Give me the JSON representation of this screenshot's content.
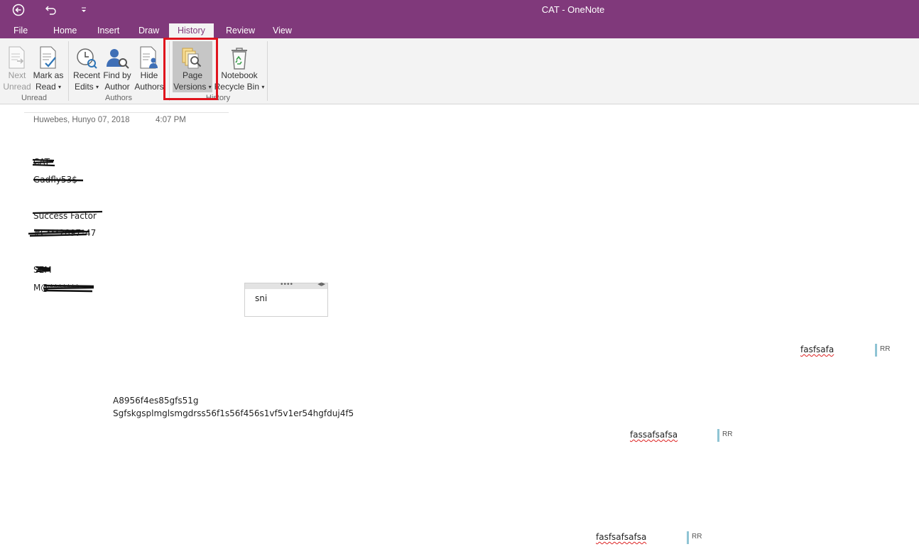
{
  "window": {
    "title": "CAT - OneNote"
  },
  "titlebar": {
    "back_icon": "back-arrow-circle-icon",
    "undo_icon": "undo-icon",
    "qat_icon": "customize-quick-access-icon"
  },
  "tabs": [
    "File",
    "Home",
    "Insert",
    "Draw",
    "History",
    "Review",
    "View"
  ],
  "active_tab": "History",
  "ribbon": {
    "next_unread": {
      "line1": "Next",
      "line2": "Unread"
    },
    "mark_as_read": {
      "line1": "Mark as",
      "line2": "Read"
    },
    "recent_edits": {
      "line1": "Recent",
      "line2": "Edits"
    },
    "find_by_author": {
      "line1": "Find by",
      "line2": "Author"
    },
    "hide_authors": {
      "line1": "Hide",
      "line2": "Authors"
    },
    "page_versions": {
      "line1": "Page",
      "line2": "Versions"
    },
    "notebook_recycle_bin": {
      "line1": "Notebook",
      "line2": "Recycle Bin"
    },
    "groups": {
      "unread": "Unread",
      "authors": "Authors",
      "history": "History"
    }
  },
  "page": {
    "date": "Huwebes, Hunyo 07, 2018",
    "time": "4:07 PM",
    "notes": [
      {
        "text": "CAT"
      },
      {
        "text": "Gadfly53$"
      },
      {
        "text": "Success Factor"
      },
      {
        "text": "#C***2897*47"
      },
      {
        "text": "SEM"
      },
      {
        "text": "M@*******"
      }
    ],
    "outline_box_text": "sni",
    "code_line1": "A8956f4es85gfs51g",
    "code_line2": "Sgfskgsplmglsmgdrss56f1s56f456s1vf5v1er54hgfduj4f5",
    "tagged": [
      {
        "text": "fasfsafa",
        "author": "RR"
      },
      {
        "text": "fassafsafsa",
        "author": "RR"
      },
      {
        "text": "fasfsafsafsa",
        "author": "RR"
      }
    ]
  },
  "colors": {
    "accent": "#80397b",
    "highlight": "#e0141d",
    "author_bar": "#8fc4d4"
  }
}
